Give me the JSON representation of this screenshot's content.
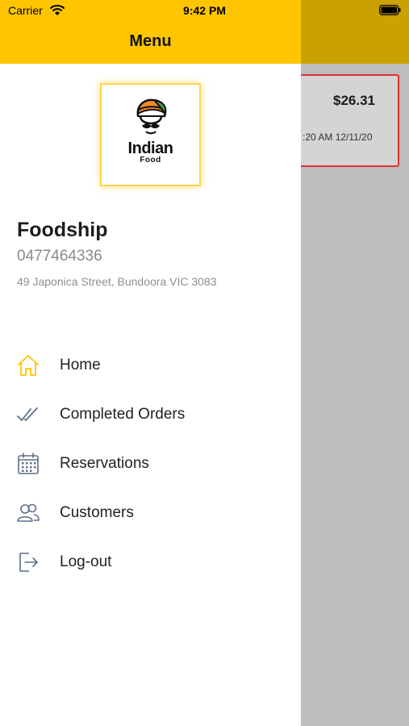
{
  "status_bar": {
    "carrier": "Carrier",
    "time": "9:42 PM"
  },
  "drawer": {
    "title": "Menu",
    "logo": {
      "title": "Indian",
      "subtitle": "Food"
    },
    "restaurant": {
      "name": "Foodship",
      "phone": "0477464336",
      "address": "49 Japonica Street, Bundoora VIC 3083"
    },
    "menu_items": [
      {
        "label": "Home",
        "icon": "home-icon"
      },
      {
        "label": "Completed Orders",
        "icon": "double-check-icon"
      },
      {
        "label": "Reservations",
        "icon": "calendar-icon"
      },
      {
        "label": "Customers",
        "icon": "users-icon"
      },
      {
        "label": "Log-out",
        "icon": "logout-icon"
      }
    ]
  },
  "background": {
    "order_card": {
      "price": "$26.31",
      "time": ":20 AM 12/11/20"
    }
  },
  "colors": {
    "accent": "#ffc500",
    "active_icon": "#ffc500",
    "inactive_icon": "#5f6f8a",
    "order_border": "#e0332f"
  }
}
